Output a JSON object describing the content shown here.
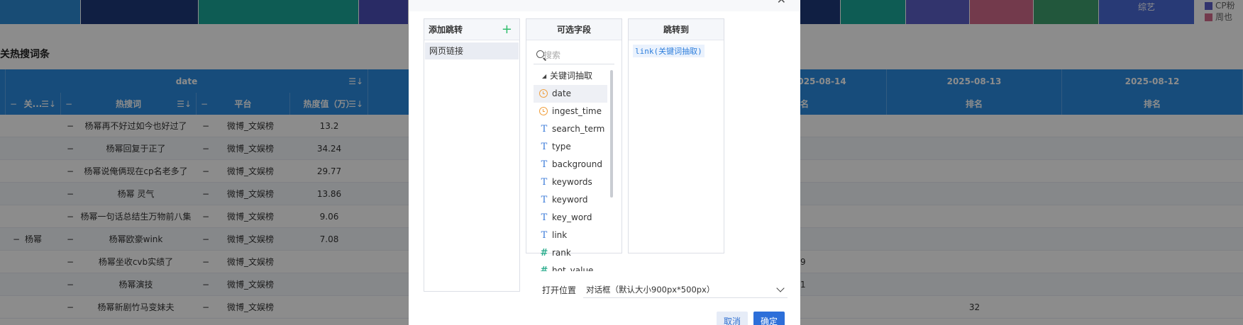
{
  "dashboard": {
    "treemap_labels": [
      "",
      "",
      "",
      "",
      "",
      "",
      "",
      "",
      "",
      "",
      "综艺"
    ],
    "legend": [
      {
        "label": "CP粉",
        "color": "#5b5fc7"
      },
      {
        "label": "周也",
        "color": "#d16b8a"
      }
    ],
    "section_title": "关热搜词条",
    "table": {
      "group_header": "date",
      "date_columns": [
        "2025-08-14",
        "2025-08-13",
        "2025-08-12"
      ],
      "columns": [
        "关...",
        "热搜词",
        "平台",
        "热度值（万）"
      ],
      "rank_label": "排名",
      "rank_partial": "名",
      "group_value": "杨幂",
      "rows": [
        {
          "term": "杨幂再不好过如今也好过了",
          "platform": "微博_文娱榜",
          "heat": "13.2",
          "rank_a": "",
          "rank_b": ""
        },
        {
          "term": "杨幂回复于正了",
          "platform": "微博_文娱榜",
          "heat": "34.24",
          "rank_a": "",
          "rank_b": ""
        },
        {
          "term": "杨幂说俺俩现在cp名老多了",
          "platform": "微博_文娱榜",
          "heat": "29.77",
          "rank_a": "",
          "rank_b": ""
        },
        {
          "term": "杨幂 灵气",
          "platform": "微博_文娱榜",
          "heat": "13.86",
          "rank_a": "",
          "rank_b": ""
        },
        {
          "term": "杨幂一句话总结生万物前八集",
          "platform": "微博_文娱榜",
          "heat": "9.06",
          "rank_a": "",
          "rank_b": ""
        },
        {
          "term": "杨幂欧豪wink",
          "platform": "微博_文娱榜",
          "heat": "7.08",
          "rank_a": "",
          "rank_b": ""
        },
        {
          "term": "杨幂坐收cvb实绩了",
          "platform": "微博_文娱榜",
          "heat": "",
          "rank_a": "9",
          "rank_b": ""
        },
        {
          "term": "杨幂演技",
          "platform": "微博_文娱榜",
          "heat": "",
          "rank_a": "1",
          "rank_b": ""
        },
        {
          "term": "杨幂新剧竹马变妹夫",
          "platform": "微博_文娱榜",
          "heat": "",
          "rank_a": "",
          "rank_b": "32"
        }
      ]
    }
  },
  "modal": {
    "add_jump_label": "添加跳转",
    "add_icon": "plus-icon",
    "jump_items": [
      "网页链接"
    ],
    "fields_header": "可选字段",
    "search_placeholder": "搜索",
    "tree_root": "关键词抽取",
    "fields": [
      {
        "name": "date",
        "type": "time"
      },
      {
        "name": "ingest_time",
        "type": "time"
      },
      {
        "name": "search_term",
        "type": "text"
      },
      {
        "name": "type",
        "type": "text"
      },
      {
        "name": "background",
        "type": "text"
      },
      {
        "name": "keywords",
        "type": "text"
      },
      {
        "name": "keyword",
        "type": "text"
      },
      {
        "name": "key_word",
        "type": "text"
      },
      {
        "name": "link",
        "type": "text"
      },
      {
        "name": "rank",
        "type": "number"
      },
      {
        "name": "hot_value",
        "type": "number"
      }
    ],
    "jump_to_header": "跳转到",
    "jump_to_value": "link(关键词抽取)",
    "open_position_label": "打开位置",
    "open_position_value": "对话框（默认大小900px*500px）",
    "cancel_label": "取消",
    "ok_label": "确定"
  }
}
